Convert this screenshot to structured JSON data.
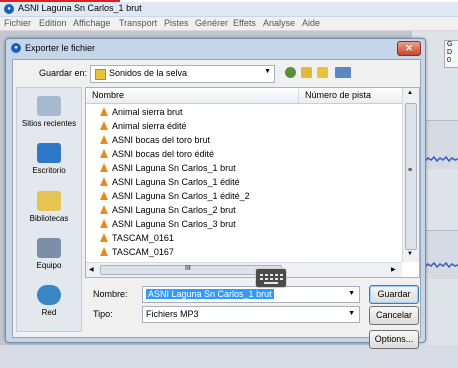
{
  "app": {
    "title": "ASNI Laguna Sn Carlos_1 brut",
    "menu": [
      "Fichier",
      "Edition",
      "Affichage",
      "Transport",
      "Pistes",
      "Générer",
      "Effets",
      "Analyse",
      "Aide"
    ],
    "ruler_values": [
      "G",
      "D",
      "0"
    ]
  },
  "dialog": {
    "title": "Exporter le fichier",
    "close_glyph": "✕",
    "save_in_label": "Guardar en:",
    "folder": "Sonidos de la selva",
    "places": [
      "Sitios recientes",
      "Escritorio",
      "Bibliotecas",
      "Equipo",
      "Red"
    ],
    "columns": {
      "name": "Nombre",
      "track": "Número de pista"
    },
    "files": [
      "Animal sierra brut",
      "Animal sierra édité",
      "ASNI bocas del toro brut",
      "ASNI bocas del toro édité",
      "ASNI Laguna Sn Carlos_1 brut",
      "ASNI Laguna Sn Carlos_1 édité",
      "ASNI Laguna Sn Carlos_1 édité_2",
      "ASNI Laguna Sn Carlos_2 brut",
      "ASNI Laguna Sn Carlos_3 brut",
      "TASCAM_0161",
      "TASCAM_0167"
    ],
    "name_label": "Nombre:",
    "name_value": "ASNI Laguna Sn Carlos_1 brut",
    "type_label": "Tipo:",
    "type_value": "Fichiers MP3",
    "buttons": {
      "save": "Guardar",
      "cancel": "Cancelar",
      "options": "Options..."
    },
    "scroll_glyphs": {
      "up": "▲",
      "down": "▼",
      "left": "◀",
      "right": "▶",
      "grip": "III",
      "splitter": "≡"
    }
  },
  "colors": {
    "accent": "#3399ff",
    "file_icon": "#e98c1c",
    "close": "#c7452a"
  }
}
